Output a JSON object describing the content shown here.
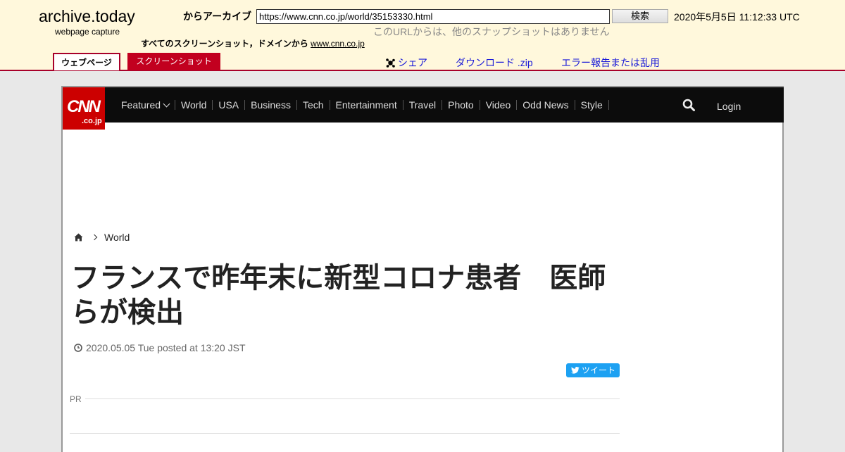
{
  "archive": {
    "title": "archive.today",
    "subtitle": "webpage capture",
    "from_label": "からアーカイブ",
    "url_value": "https://www.cnn.co.jp/world/35153330.html",
    "search_label": "検索",
    "date": "2020年5月5日 11:12:33 UTC",
    "no_snapshots": "このURLからは、他のスナップショットはありません",
    "all_screens": "すべてのスクリーンショット，ドメインから",
    "domain_link": "www.cnn.co.jp",
    "tabs": {
      "webpage": "ウェブページ",
      "screenshot": "スクリーンショット"
    },
    "links": {
      "share": "シェア",
      "download": "ダウンロード .zip",
      "report": "エラー報告または乱用"
    }
  },
  "cnn": {
    "logo_main": "CNN",
    "logo_sub": ".co.jp",
    "nav": [
      "Featured",
      "World",
      "USA",
      "Business",
      "Tech",
      "Entertainment",
      "Travel",
      "Photo",
      "Video",
      "Odd News",
      "Style"
    ],
    "login": "Login"
  },
  "article": {
    "breadcrumb": "World",
    "headline": "フランスで昨年末に新型コロナ患者　医師らが検出",
    "posted": "2020.05.05 Tue posted at 13:20 JST",
    "tweet": "ツイート",
    "pr": "PR"
  },
  "colors": {
    "archive_bg": "#fff8dc",
    "archive_accent": "#a8002a",
    "cnn_red": "#cc0000",
    "twitter": "#1da1f2"
  }
}
